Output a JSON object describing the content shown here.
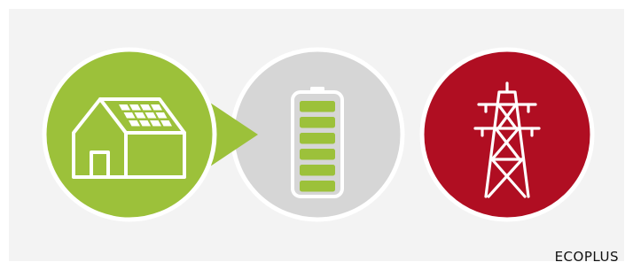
{
  "brand": {
    "label": "ECOPLUS"
  },
  "colors": {
    "background": "#f3f3f3",
    "house_circle": "#9cc13a",
    "battery_circle": "#d6d6d6",
    "grid_circle": "#b00e22",
    "battery_cells": "#9cc13a",
    "outline": "#ffffff"
  },
  "icons": {
    "house": "solar-house-icon",
    "battery": "battery-icon",
    "grid": "power-pylon-icon",
    "connector": "arrow-icon"
  },
  "battery": {
    "level": 1.0,
    "cells": 6
  }
}
